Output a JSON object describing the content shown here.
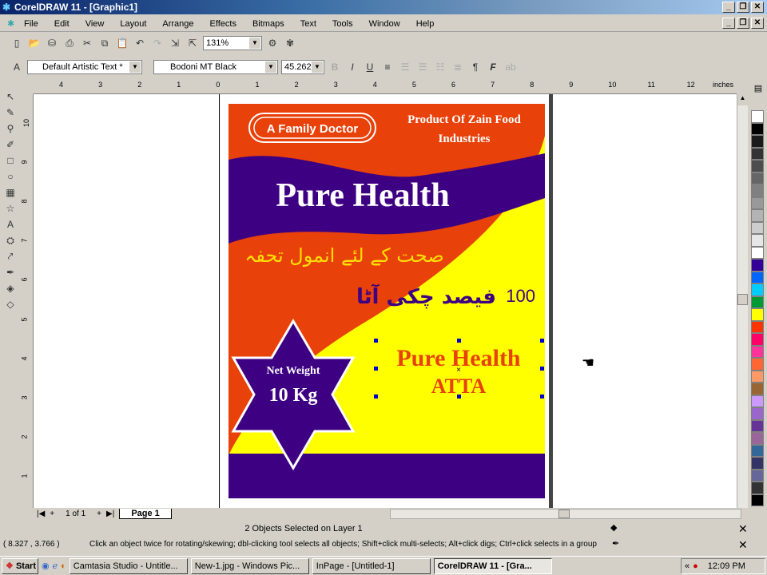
{
  "window": {
    "title": "CorelDRAW 11 - [Graphic1]"
  },
  "menu": [
    "File",
    "Edit",
    "View",
    "Layout",
    "Arrange",
    "Effects",
    "Bitmaps",
    "Text",
    "Tools",
    "Window",
    "Help"
  ],
  "toolbar": {
    "zoom": "131%"
  },
  "propbar": {
    "style": "Default Artistic Text *",
    "font": "Bodoni MT Black",
    "size": "45.262"
  },
  "ruler": {
    "unit": "inches",
    "top_labels": [
      "4",
      "3",
      "2",
      "1",
      "0",
      "1",
      "2",
      "3",
      "4",
      "5",
      "6",
      "7",
      "8",
      "9",
      "10",
      "11",
      "12"
    ],
    "left_labels": [
      "10",
      "9",
      "8",
      "7",
      "6",
      "5",
      "4",
      "3",
      "2",
      "1"
    ]
  },
  "artwork": {
    "badge": "A Family Doctor",
    "product": "Product Of Zain Food",
    "product2": "Industries",
    "brand": "Pure Health",
    "urdu1": "صحت کے لئے انمول تحفہ",
    "urdu2_num": "100",
    "urdu2": "فیصد چکی آٹا",
    "net": "Net Weight",
    "weight": "10 Kg",
    "sel1": "Pure Health",
    "sel2": "ATTA"
  },
  "pages": {
    "count": "1 of 1",
    "tab": "Page 1"
  },
  "status": {
    "selection": "2 Objects Selected on Layer 1",
    "coords": "( 8.327 , 3.766 )",
    "hint": "Click an object twice for rotating/skewing; dbl-clicking tool selects all objects; Shift+click multi-selects; Alt+click digs; Ctrl+click selects in a group"
  },
  "taskbar": {
    "start": "Start",
    "tasks": [
      "Camtasia Studio - Untitle...",
      "New-1.jpg - Windows Pic...",
      "InPage - [Untitled-1]",
      "CorelDRAW 11 - [Gra..."
    ],
    "clock": "12:09 PM"
  },
  "palette": [
    "#ffffff",
    "#000000",
    "#1a1a1a",
    "#333333",
    "#4d4d4d",
    "#666666",
    "#808080",
    "#999999",
    "#b3b3b3",
    "#cccccc",
    "#e6e6e6",
    "#ffffff",
    "#330099",
    "#0066ff",
    "#00ccff",
    "#009933",
    "#ffff00",
    "#ff3300",
    "#ff0066",
    "#ff3399",
    "#ff6633",
    "#ff9966",
    "#996633",
    "#cc99ff",
    "#9966cc",
    "#663399",
    "#996699",
    "#336699",
    "#333366",
    "#666699",
    "#333333",
    "#000000"
  ]
}
